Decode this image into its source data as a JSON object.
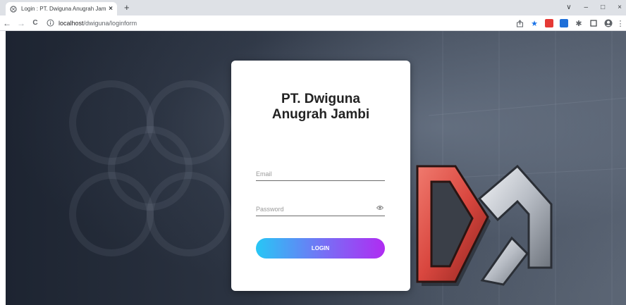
{
  "browser": {
    "tab_title": "Login : PT. Dwiguna Anugrah Jam",
    "tab_close": "×",
    "new_tab": "+",
    "url_host": "localhost",
    "url_path": "/dwiguna/loginform",
    "window_controls": [
      "∨",
      "–",
      "□",
      "×"
    ],
    "nav": {
      "back": "←",
      "forward": "→",
      "reload": "C"
    },
    "icons": [
      "share-icon",
      "bookmark-star-icon",
      "extension-red-icon",
      "extension-blue-icon",
      "puzzle-icon",
      "sidebar-icon",
      "profile-icon",
      "menu-icon"
    ]
  },
  "login": {
    "title_line1": "PT. Dwiguna",
    "title_line2": "Anugrah Jambi",
    "email_placeholder": "Email",
    "password_placeholder": "Password",
    "button_label": "LOGIN"
  },
  "colors": {
    "button_gradient_start": "#27c7f5",
    "button_gradient_end": "#b02cf2",
    "logo_red": "#d9473f",
    "logo_silver": "#c9ced6"
  }
}
